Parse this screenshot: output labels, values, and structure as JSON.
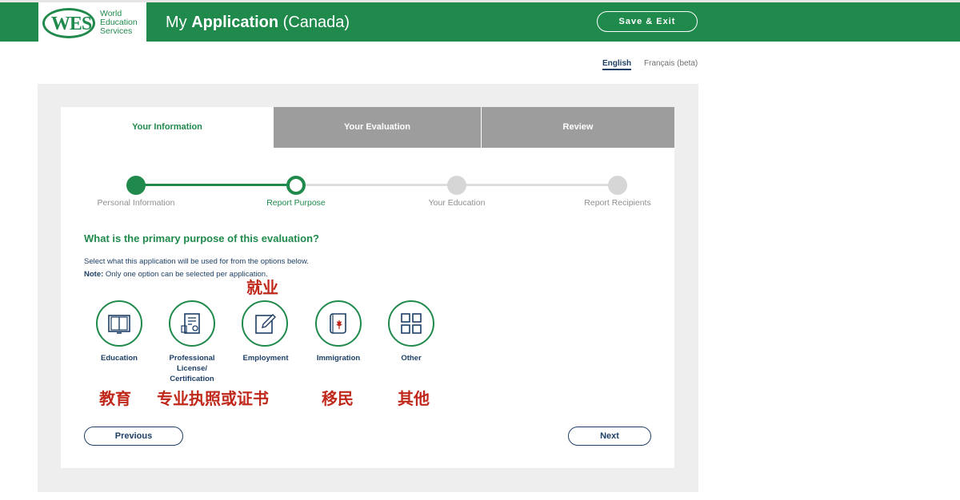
{
  "header": {
    "logo_mark": "WES",
    "logo_lines": [
      "World",
      "Education",
      "Services"
    ],
    "title_prefix": "My ",
    "title_bold": "Application",
    "title_suffix": " (Canada)",
    "save_exit_label": "Save & Exit"
  },
  "language": {
    "english": "English",
    "french": "Français (beta)"
  },
  "tabs": [
    {
      "label": "Your Information",
      "active": true
    },
    {
      "label": "Your Evaluation",
      "active": false
    },
    {
      "label": "Review",
      "active": false
    }
  ],
  "steps": [
    {
      "label": "Personal Information",
      "state": "completed"
    },
    {
      "label": "Report Purpose",
      "state": "current"
    },
    {
      "label": "Your Education",
      "state": "upcoming"
    },
    {
      "label": "Report Recipients",
      "state": "upcoming"
    }
  ],
  "question": {
    "title": "What is the primary purpose of this evaluation?",
    "description": "Select what this application will be used for from the options below.",
    "note_label": "Note:",
    "note_text": " Only one option can be selected per application."
  },
  "options": [
    {
      "label": "Education",
      "icon": "book-icon"
    },
    {
      "label_lines": [
        "Professional",
        "License/",
        "Certification"
      ],
      "icon": "certificate-icon"
    },
    {
      "label": "Employment",
      "icon": "edit-document-icon"
    },
    {
      "label": "Immigration",
      "icon": "maple-leaf-scroll-icon"
    },
    {
      "label": "Other",
      "icon": "grid-icon"
    }
  ],
  "annotations": {
    "employment": "就业",
    "education": "教育",
    "professional": "专业执照或证书",
    "immigration": "移民",
    "other": "其他"
  },
  "buttons": {
    "previous": "Previous",
    "next": "Next"
  },
  "colors": {
    "brand_green": "#1f8a4c",
    "navy": "#1d3f66",
    "tab_inactive": "#9d9d9d",
    "annotation_red": "#c0281b"
  }
}
